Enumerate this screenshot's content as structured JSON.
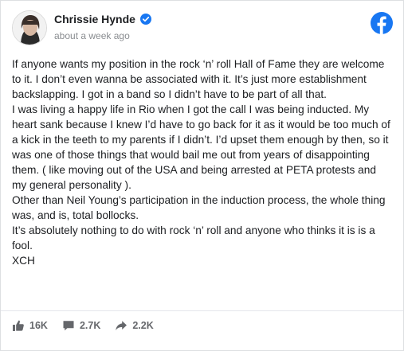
{
  "post": {
    "author": "Chrissie Hynde",
    "timestamp": "about a week ago",
    "paragraphs": [
      "If anyone wants my position in the rock ‘n’ roll Hall of Fame they are welcome to it. I don’t even wanna be associated with it. It’s just more establishment backslapping. I got in a band so I didn’t have to be part of all that.",
      "I was living a happy life in Rio when I got the call I was being inducted. My heart sank because I knew I’d have to go back for it as it would be too much of a kick in the teeth to my parents if I didn’t. I’d upset them enough by then, so it was one of those things that would bail me out from years of disappointing them. ( like moving out of the USA and being arrested at PETA protests and my general personality ).",
      "Other than Neil Young’s participation in the induction process, the whole thing was, and is, total bollocks.",
      "It’s absolutely nothing to do with rock ‘n’ roll and anyone who thinks it is is a fool.",
      "XCH"
    ]
  },
  "stats": {
    "likes": "16K",
    "comments": "2.7K",
    "shares": "2.2K"
  },
  "icons": {
    "verified": "verified-badge-icon",
    "brand": "facebook-logo-icon",
    "likes": "thumbs-up-icon",
    "comments": "comment-icon",
    "shares": "share-arrow-icon"
  },
  "colors": {
    "brand": "#1877f2",
    "text": "#1c1e21",
    "muted": "#8a8d91",
    "stat": "#65676b"
  }
}
